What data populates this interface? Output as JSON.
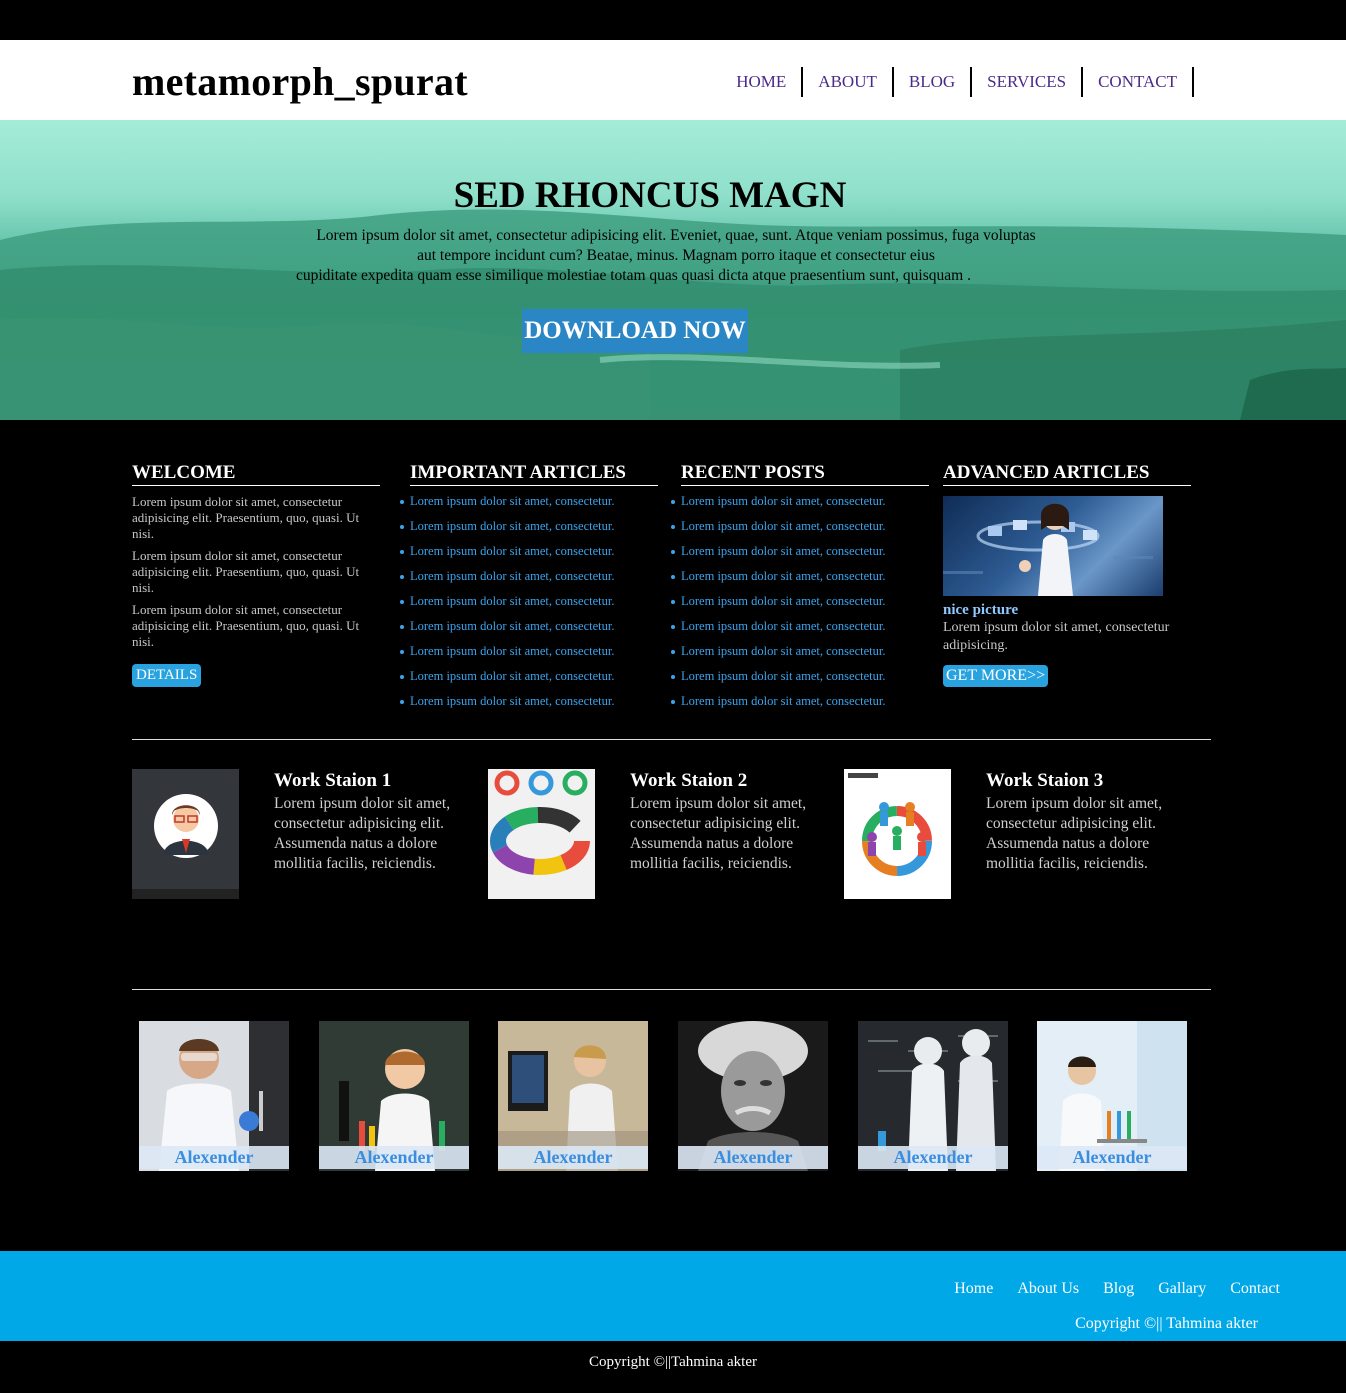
{
  "site": {
    "logo": "metamorph_spurat"
  },
  "nav": [
    "HOME",
    "ABOUT",
    "BLOG",
    "SERVICES",
    "CONTACT"
  ],
  "hero": {
    "title": "SED RHONCUS MAGN",
    "text_line1": "Lorem ipsum dolor sit amet, consectetur adipisicing elit. Eveniet, quae, sunt. Atque veniam possimus, fuga voluptas",
    "text_line2": "aut tempore incidunt cum? Beatae, minus. Magnam porro itaque et consectetur eius",
    "text_line3": "cupiditate expedita quam esse similique molestiae totam quas quasi dicta atque praesentium sunt, quisquam .",
    "button": "DOWNLOAD NOW"
  },
  "welcome": {
    "heading": "WELCOME",
    "paragraphs": [
      "Lorem ipsum dolor sit amet, consectetur adipisicing elit. Praesentium, quo, quasi. Ut nisi.",
      "Lorem ipsum dolor sit amet, consectetur adipisicing elit. Praesentium, quo, quasi. Ut nisi.",
      "Lorem ipsum dolor sit amet, consectetur adipisicing elit. Praesentium, quo, quasi. Ut nisi."
    ],
    "button": "DETAILS"
  },
  "important": {
    "heading": "IMPORTANT ARTICLES",
    "items": [
      "Lorem ipsum dolor sit amet, consectetur.",
      "Lorem ipsum dolor sit amet, consectetur.",
      "Lorem ipsum dolor sit amet, consectetur.",
      "Lorem ipsum dolor sit amet, consectetur.",
      "Lorem ipsum dolor sit amet, consectetur.",
      "Lorem ipsum dolor sit amet, consectetur.",
      "Lorem ipsum dolor sit amet, consectetur.",
      "Lorem ipsum dolor sit amet, consectetur.",
      "Lorem ipsum dolor sit amet, consectetur."
    ]
  },
  "recent": {
    "heading": "RECENT POSTS",
    "items": [
      "Lorem ipsum dolor sit amet, consectetur.",
      "Lorem ipsum dolor sit amet, consectetur.",
      "Lorem ipsum dolor sit amet, consectetur.",
      "Lorem ipsum dolor sit amet, consectetur.",
      "Lorem ipsum dolor sit amet, consectetur.",
      "Lorem ipsum dolor sit amet, consectetur.",
      "Lorem ipsum dolor sit amet, consectetur.",
      "Lorem ipsum dolor sit amet, consectetur.",
      "Lorem ipsum dolor sit amet, consectetur."
    ]
  },
  "advanced": {
    "heading": "ADVANCED ARTICLES",
    "caption": "nice picture",
    "text": "Lorem ipsum dolor sit amet, consectetur adipisicing.",
    "button": "GET MORE>>"
  },
  "workstations": [
    {
      "title": "Work Staion 1",
      "text": "Lorem ipsum dolor sit amet, consectetur adipisicing elit. Assumenda natus a dolore mollitia facilis, reiciendis."
    },
    {
      "title": "Work Staion 2",
      "text": "Lorem ipsum dolor sit amet, consectetur adipisicing elit. Assumenda natus a dolore mollitia facilis, reiciendis."
    },
    {
      "title": "Work Staion 3",
      "text": "Lorem ipsum dolor sit amet, consectetur adipisicing elit. Assumenda natus a dolore mollitia facilis, reiciendis."
    }
  ],
  "team": [
    "Alexender",
    "Alexender",
    "Alexender",
    "Alexender",
    "Alexender",
    "Alexender"
  ],
  "footer": {
    "nav": [
      "Home",
      "About Us",
      "Blog",
      "Gallary",
      "Contact"
    ],
    "copyright": "Copyright ©|| Tahmina akter"
  },
  "bottom_copyright": "Copyright ©||Tahmina akter"
}
